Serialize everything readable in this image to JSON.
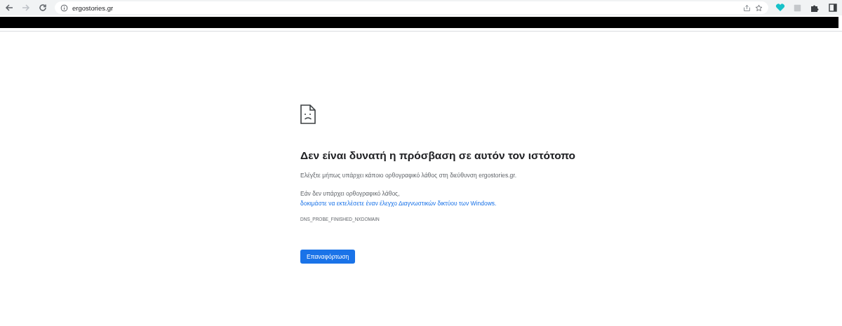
{
  "browser": {
    "url": "ergostories.gr"
  },
  "error": {
    "title": "Δεν είναι δυνατή η πρόσβαση σε αυτόν τον ιστότοπο",
    "message": "Ελέγξτε μήπως υπάρχει κάποιο ορθογραφικό λάθος στη διεύθυνση ergostories.gr.",
    "suggestion": "Εάν δεν υπάρχει ορθογραφικό λάθος,",
    "suggestion_link": "δοκιμάστε να εκτελέσετε έναν έλεγχο Διαγνωστικών δικτύου των Windows.",
    "code": "DNS_PROBE_FINISHED_NXDOMAIN",
    "button": "Επαναφόρτωση"
  }
}
